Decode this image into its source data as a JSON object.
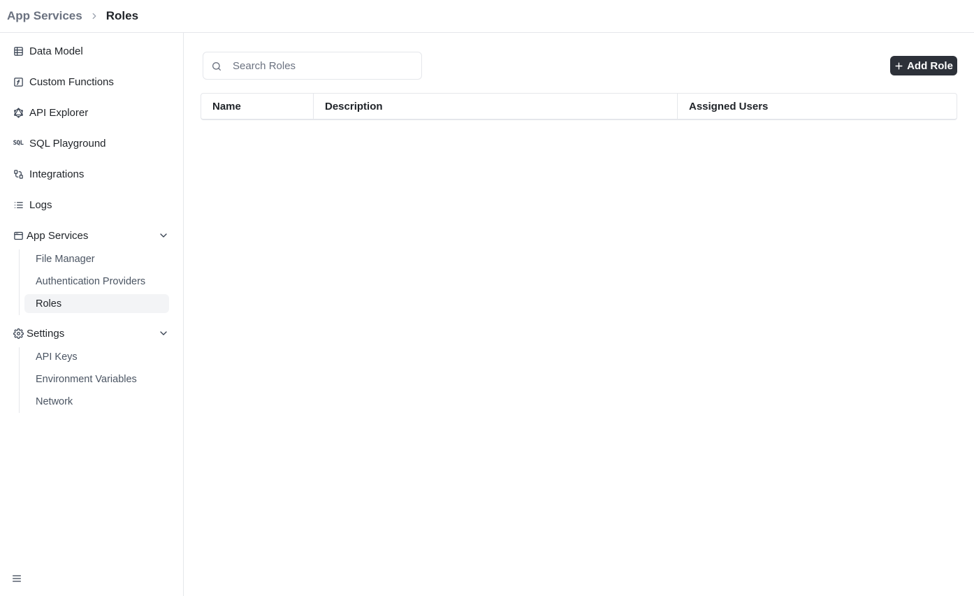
{
  "breadcrumb": {
    "parent": "App Services",
    "current": "Roles"
  },
  "sidebar": {
    "items": [
      {
        "label": "Data Model",
        "icon": "table-icon"
      },
      {
        "label": "Custom Functions",
        "icon": "function-icon"
      },
      {
        "label": "API Explorer",
        "icon": "graphql-icon"
      },
      {
        "label": "SQL Playground",
        "icon": "sql-icon"
      },
      {
        "label": "Integrations",
        "icon": "integrations-icon"
      },
      {
        "label": "Logs",
        "icon": "list-icon"
      }
    ],
    "groups": [
      {
        "label": "App Services",
        "icon": "window-icon",
        "expanded": true,
        "children": [
          "File Manager",
          "Authentication Providers",
          "Roles"
        ],
        "active_child": "Roles"
      },
      {
        "label": "Settings",
        "icon": "gear-icon",
        "expanded": true,
        "children": [
          "API Keys",
          "Environment Variables",
          "Network"
        ]
      }
    ],
    "sql_glyph": "SQL"
  },
  "main": {
    "search": {
      "placeholder": "Search Roles",
      "value": ""
    },
    "add_button_label": "Add Role",
    "table": {
      "columns": [
        "Name",
        "Description",
        "Assigned Users"
      ],
      "rows": []
    }
  },
  "colors": {
    "primary_button": "#2d3139",
    "border": "#e5e7eb",
    "active_bg": "#f3f4f6",
    "muted_text": "#6b7280"
  }
}
